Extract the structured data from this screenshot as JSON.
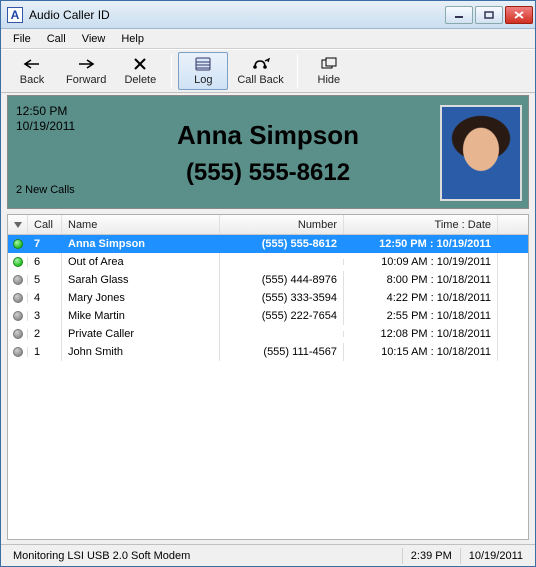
{
  "window": {
    "title": "Audio Caller ID"
  },
  "menu": {
    "items": [
      "File",
      "Call",
      "View",
      "Help"
    ]
  },
  "toolbar": {
    "back": "Back",
    "forward": "Forward",
    "delete": "Delete",
    "log": "Log",
    "callback": "Call Back",
    "hide": "Hide",
    "active": "log"
  },
  "panel": {
    "time": "12:50 PM",
    "date": "10/19/2011",
    "new_calls": "2 New Calls",
    "caller_name": "Anna Simpson",
    "caller_number": "(555) 555-8612"
  },
  "table": {
    "headers": {
      "call": "Call",
      "name": "Name",
      "number": "Number",
      "time": "Time : Date"
    },
    "rows": [
      {
        "color": "green",
        "call": "7",
        "name": "Anna Simpson",
        "number": "(555) 555-8612",
        "time": "12:50 PM : 10/19/2011",
        "selected": true
      },
      {
        "color": "green",
        "call": "6",
        "name": "Out of Area",
        "number": "",
        "time": "10:09 AM : 10/19/2011",
        "selected": false
      },
      {
        "color": "gray",
        "call": "5",
        "name": "Sarah Glass",
        "number": "(555) 444-8976",
        "time": "8:00 PM : 10/18/2011",
        "selected": false
      },
      {
        "color": "gray",
        "call": "4",
        "name": "Mary Jones",
        "number": "(555) 333-3594",
        "time": "4:22 PM : 10/18/2011",
        "selected": false
      },
      {
        "color": "gray",
        "call": "3",
        "name": "Mike Martin",
        "number": "(555) 222-7654",
        "time": "2:55 PM : 10/18/2011",
        "selected": false
      },
      {
        "color": "gray",
        "call": "2",
        "name": "Private Caller",
        "number": "",
        "time": "12:08 PM : 10/18/2011",
        "selected": false
      },
      {
        "color": "gray",
        "call": "1",
        "name": "John Smith",
        "number": "(555) 111-4567",
        "time": "10:15 AM : 10/18/2011",
        "selected": false
      }
    ]
  },
  "status": {
    "text": "Monitoring LSI USB 2.0 Soft Modem",
    "time": "2:39 PM",
    "date": "10/19/2011"
  }
}
